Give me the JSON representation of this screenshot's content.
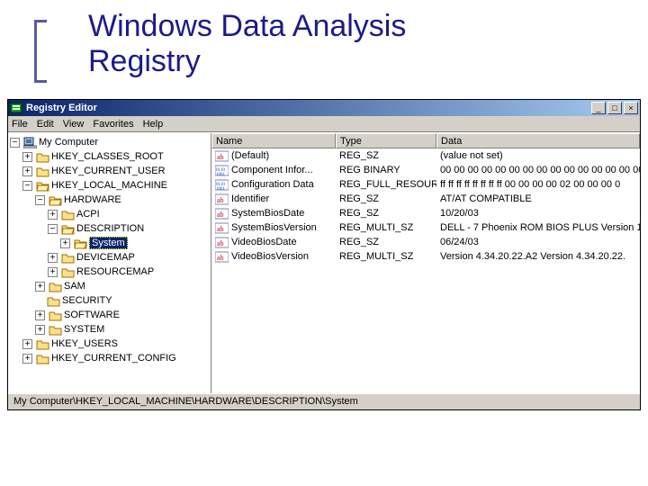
{
  "slide": {
    "title_line1": "Windows Data Analysis",
    "title_line2": "Registry"
  },
  "window": {
    "title": "Registry Editor",
    "menus": [
      "File",
      "Edit",
      "View",
      "Favorites",
      "Help"
    ],
    "statuspath": "My Computer\\HKEY_LOCAL_MACHINE\\HARDWARE\\DESCRIPTION\\System",
    "controls": {
      "minimize": "_",
      "maximize": "□",
      "close": "×"
    }
  },
  "tree": {
    "root": "My Computer",
    "hives": {
      "h0": "HKEY_CLASSES_ROOT",
      "h1": "HKEY_CURRENT_USER",
      "h2": "HKEY_LOCAL_MACHINE",
      "h3": "HKEY_USERS",
      "h4": "HKEY_CURRENT_CONFIG"
    },
    "hlm_children": {
      "c0": "HARDWARE",
      "c1": "SAM",
      "c2": "SECURITY",
      "c3": "SOFTWARE",
      "c4": "SYSTEM"
    },
    "hardware_children": {
      "a0": "ACPI",
      "a1": "DESCRIPTION",
      "a2": "DEVICEMAP",
      "a3": "RESOURCEMAP"
    },
    "desc_children": {
      "d0": "System"
    }
  },
  "listview": {
    "headers": {
      "name": "Name",
      "type": "Type",
      "data": "Data"
    },
    "rows": [
      {
        "icon": "str",
        "name": "(Default)",
        "type": "REG_SZ",
        "data": "(value not set)"
      },
      {
        "icon": "bin",
        "name": "Component Infor...",
        "type": "REG BINARY",
        "data": "00 00 00 00 00 00 00 00 00 00 00 00 00 00 00"
      },
      {
        "icon": "bin",
        "name": "Configuration Data",
        "type": "REG_FULL_RESOUR ..",
        "data": "ff ff ff ff ff ff ff ff 00 00 00 00 02 00 00 00 0"
      },
      {
        "icon": "str",
        "name": "Identifier",
        "type": "REG_SZ",
        "data": "AT/AT COMPATIBLE"
      },
      {
        "icon": "str",
        "name": "SystemBiosDate",
        "type": "REG_SZ",
        "data": "10/20/03"
      },
      {
        "icon": "str",
        "name": "SystemBiosVersion",
        "type": "REG_MULTI_SZ",
        "data": "DELL   - 7 Phoenix ROM BIOS PLUS Version 1."
      },
      {
        "icon": "str",
        "name": "VideoBiosDate",
        "type": "REG_SZ",
        "data": "06/24/03"
      },
      {
        "icon": "str",
        "name": "VideoBiosVersion",
        "type": "REG_MULTI_SZ",
        "data": "Version 4.34.20.22.A2  Version 4.34.20.22."
      }
    ]
  }
}
